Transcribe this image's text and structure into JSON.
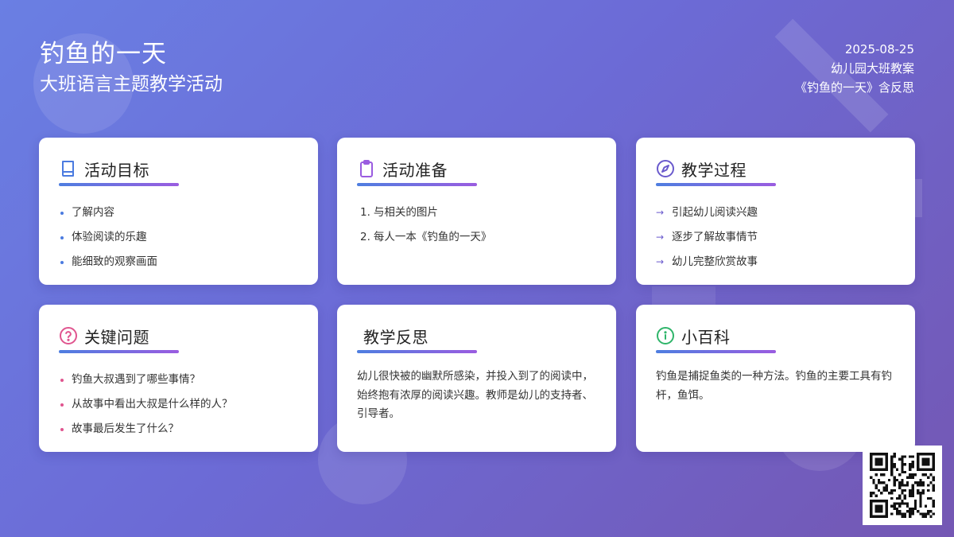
{
  "header": {
    "title": "钓鱼的一天",
    "subtitle": "大班语言主题教学活动",
    "date": "2025-08-25",
    "plan_type": "幼儿园大班教案",
    "plan_name": "《钓鱼的一天》含反思"
  },
  "cards": {
    "goals": {
      "icon": "book-icon",
      "title": "活动目标",
      "items": [
        "了解内容",
        "体验阅读的乐趣",
        "能细致的观察画面"
      ]
    },
    "prep": {
      "icon": "clipboard-icon",
      "title": "活动准备",
      "items": [
        "与相关的图片",
        "每人一本《钓鱼的一天》"
      ]
    },
    "process": {
      "icon": "compass-icon",
      "title": "教学过程",
      "items": [
        "引起幼儿阅读兴趣",
        "逐步了解故事情节",
        "幼儿完整欣赏故事"
      ]
    },
    "questions": {
      "icon": "question-circle-icon",
      "title": "关键问题",
      "items": [
        "钓鱼大叔遇到了哪些事情？",
        "从故事中看出大叔是什么样的人？",
        "故事最后发生了什么？"
      ]
    },
    "reflection": {
      "title": "教学反思",
      "text": "幼儿很快被的幽默所感染，并投入到了的阅读中，始终抱有浓厚的阅读兴趣。教师是幼儿的支持者、引导者。"
    },
    "wiki": {
      "icon": "info-circle-icon",
      "title": "小百科",
      "text": "钓鱼是捕捉鱼类的一种方法。钓鱼的主要工具有钓杆，鱼饵。"
    }
  },
  "colors": {
    "accent_blue": "#4b7be0",
    "accent_purple": "#9a5ce0",
    "question_pink": "#e0558f",
    "info_green": "#2fb56a",
    "process_indigo": "#6a5acd"
  },
  "qr": {
    "icon": "qr-code"
  }
}
